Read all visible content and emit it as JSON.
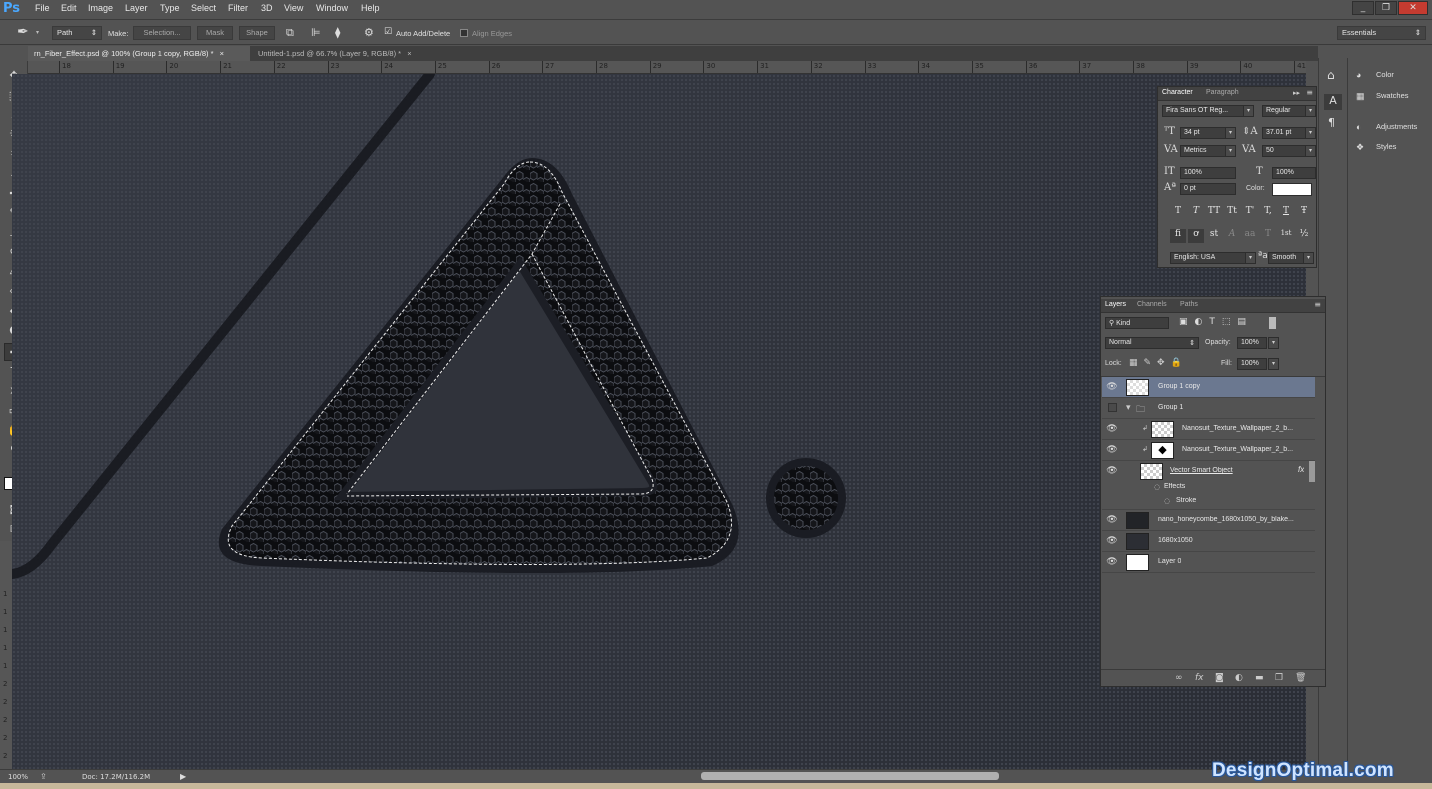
{
  "app": {
    "logo": "Ps"
  },
  "menu": [
    "File",
    "Edit",
    "Image",
    "Layer",
    "Type",
    "Select",
    "Filter",
    "3D",
    "View",
    "Window",
    "Help"
  ],
  "window_controls": [
    "_",
    "❐",
    "✕"
  ],
  "options": {
    "mode": "Path",
    "make_label": "Make:",
    "selection_btn": "Selection...",
    "mask_btn": "Mask",
    "shape_btn": "Shape",
    "auto_add_delete": "Auto Add/Delete",
    "align_edges": "Align Edges",
    "workspace": "Essentials"
  },
  "tabs": [
    {
      "label": "rn_Fiber_Effect.psd @ 100% (Group 1 copy, RGB/8) *",
      "close": "×"
    },
    {
      "label": "Untitled-1.psd @ 66.7% (Layer 9, RGB/8) *",
      "close": "×"
    }
  ],
  "ruler_top": [
    "18",
    "19",
    "20",
    "21",
    "22",
    "23",
    "24",
    "25",
    "26",
    "27",
    "28",
    "29",
    "30",
    "31",
    "32",
    "33",
    "34",
    "35",
    "36",
    "37",
    "38",
    "39",
    "40",
    "41"
  ],
  "ruler_left": [
    "1",
    "1",
    "1",
    "1",
    "1",
    "2",
    "2",
    "2",
    "2",
    "2"
  ],
  "status": {
    "zoom": "100%",
    "doc": "Doc: 17.2M/116.2M"
  },
  "right_panel": {
    "items": [
      {
        "icon": "palette-icon",
        "label": "Color"
      },
      {
        "icon": "swatches-icon",
        "label": "Swatches"
      },
      {
        "icon": "adjustments-icon",
        "label": "Adjustments"
      },
      {
        "icon": "styles-icon",
        "label": "Styles"
      }
    ]
  },
  "character": {
    "tabs": [
      "Character",
      "Paragraph"
    ],
    "font_family": "Fira Sans OT Reg...",
    "font_style": "Regular",
    "size": "34 pt",
    "leading": "37.01 pt",
    "kerning": "Metrics",
    "tracking": "50",
    "vscale": "100%",
    "hscale": "100%",
    "baseline": "0 pt",
    "color_label": "Color:",
    "color_value": "#ffffff",
    "style_glyphs": [
      "T",
      "T",
      "TT",
      "Tt",
      "T'",
      "T,",
      "T",
      "Ŧ"
    ],
    "ot_glyphs": [
      "fi",
      "ơ",
      "st",
      "A",
      "aa",
      "T",
      "1st",
      "½"
    ],
    "language": "English: USA",
    "aa_label": "a",
    "antialias": "Smooth"
  },
  "layers": {
    "tabs": [
      "Layers",
      "Channels",
      "Paths"
    ],
    "kind": "Kind",
    "blend": "Normal",
    "opacity_label": "Opacity:",
    "opacity": "100%",
    "lock_label": "Lock:",
    "fill_label": "Fill:",
    "fill": "100%",
    "rows": [
      {
        "name": "Group 1 copy",
        "selected": true,
        "visible": true
      },
      {
        "name": "Group 1",
        "group": true,
        "visible": false
      },
      {
        "name": "Nanosuit_Texture_Wallpaper_2_b...",
        "visible": true
      },
      {
        "name": "Nanosuit_Texture_Wallpaper_2_b...",
        "visible": true
      },
      {
        "name": "Vector Smart Object",
        "visible": true,
        "fx": "fx"
      },
      {
        "name": "Effects",
        "sub": true
      },
      {
        "name": "Stroke",
        "sub": true
      },
      {
        "name": "nano_honeycombe_1680x1050_by_blake...",
        "visible": true
      },
      {
        "name": "1680x1050",
        "visible": true
      },
      {
        "name": "Layer 0",
        "visible": true
      }
    ],
    "footer_icons": [
      "link-icon",
      "fx-icon",
      "mask-icon",
      "adjustment-icon",
      "folder-icon",
      "new-layer-icon",
      "trash-icon"
    ]
  },
  "watermark": "DesignOptimal.com"
}
